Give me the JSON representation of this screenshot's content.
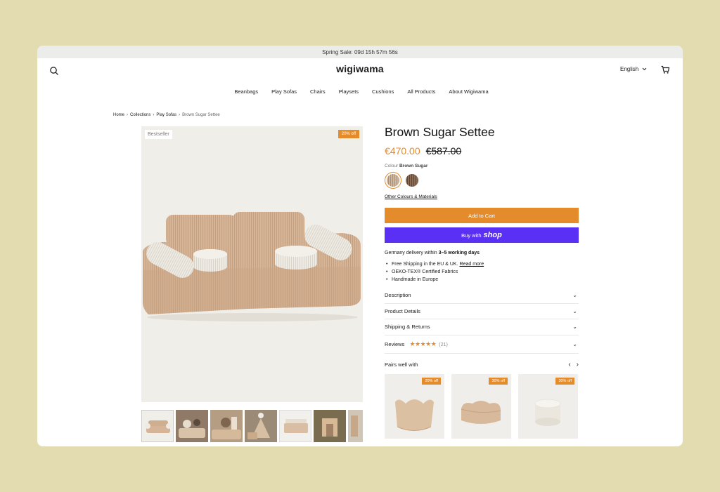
{
  "announcement": "Spring Sale: 09d 15h 57m 56s",
  "header": {
    "logo": "wigiwama",
    "language": "English",
    "icons": [
      "search-icon",
      "cart-icon",
      "chevron-down-icon"
    ]
  },
  "nav": [
    "Beanbags",
    "Play Sofas",
    "Chairs",
    "Playsets",
    "Cushions",
    "All Products",
    "About Wigiwama"
  ],
  "breadcrumb": [
    "Home",
    "Collections",
    "Play Sofas",
    "Brown Sugar Settee"
  ],
  "gallery": {
    "badge_left": "Bestseller",
    "badge_right": "20% off",
    "thumbnail_count": 7
  },
  "product": {
    "title": "Brown Sugar Settee",
    "sale_price": "€470.00",
    "original_price": "€587.00",
    "colour_label": "Colour",
    "colour_value": "Brown Sugar",
    "other_colours": "Other Colours & Materials",
    "add_to_cart": "Add to Cart",
    "buy_with": "Buy with",
    "shop_word": "shop",
    "delivery_prefix": "Germany delivery within",
    "delivery_bold": "3–5 working days",
    "features": {
      "shipping": "Free Shipping in the EU & UK.",
      "read_more": "Read more",
      "oeko": "OEKO-TEX® Certified Fabrics",
      "handmade": "Handmade in Europe"
    },
    "accordion": {
      "description": "Description",
      "details": "Product Details",
      "shipping": "Shipping & Returns",
      "reviews": "Reviews",
      "stars": "★★★★★",
      "review_count": "(21)"
    }
  },
  "pairs": {
    "title": "Pairs well with",
    "cards": [
      {
        "badge": "20% off"
      },
      {
        "badge": "30% off"
      },
      {
        "badge": "30% off"
      }
    ]
  },
  "colors": {
    "accent": "#e48c2c",
    "shop_pay": "#5a31f4",
    "background": "#e2dcb0"
  }
}
